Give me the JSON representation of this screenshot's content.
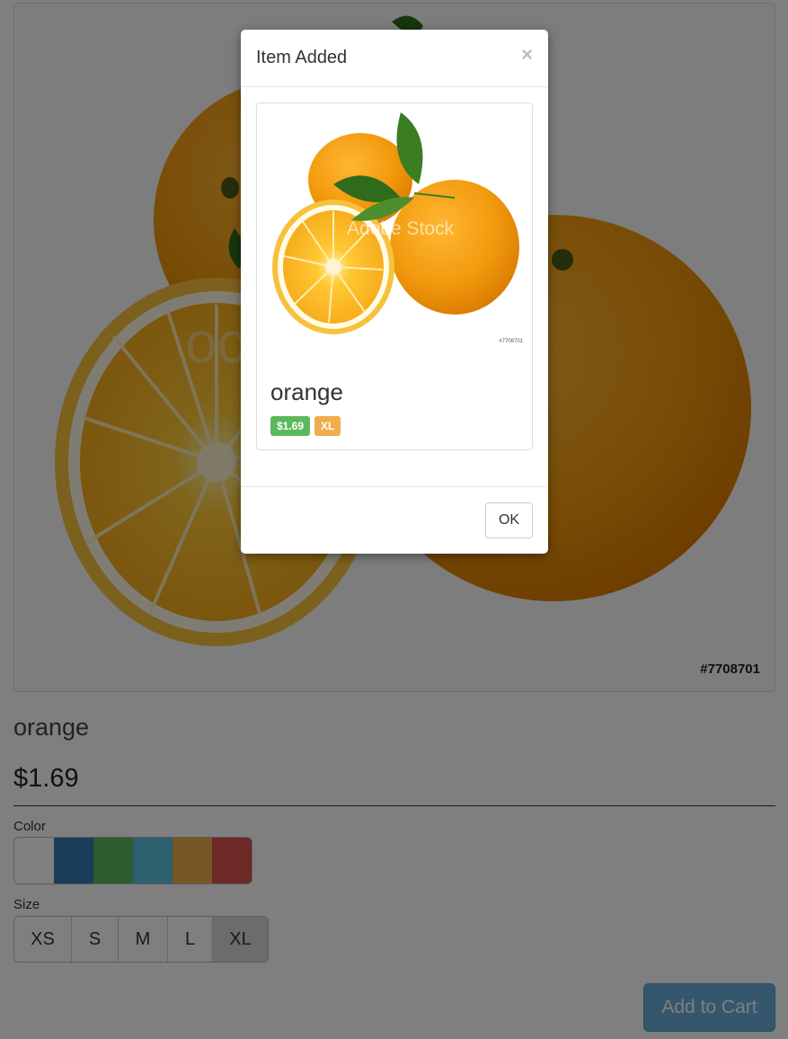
{
  "product": {
    "image_alt": "orange",
    "watermark": "ock",
    "stock_number": "#7708701",
    "name": "orange",
    "price": "$1.69"
  },
  "color": {
    "label": "Color",
    "swatches": [
      "#ffffff",
      "#337ab7",
      "#5cb85c",
      "#5bc0de",
      "#f0ad4e",
      "#d9534f"
    ]
  },
  "size": {
    "label": "Size",
    "options": [
      "XS",
      "S",
      "M",
      "L",
      "XL"
    ],
    "selected": "XL"
  },
  "cart": {
    "add_label": "Add to Cart"
  },
  "modal": {
    "title": "Item Added",
    "close_glyph": "×",
    "thumb_watermark": "Adobe Stock",
    "thumb_stock_number": "#7708701",
    "item_name": "orange",
    "price_badge": "$1.69",
    "size_badge": "XL",
    "ok_label": "OK"
  }
}
